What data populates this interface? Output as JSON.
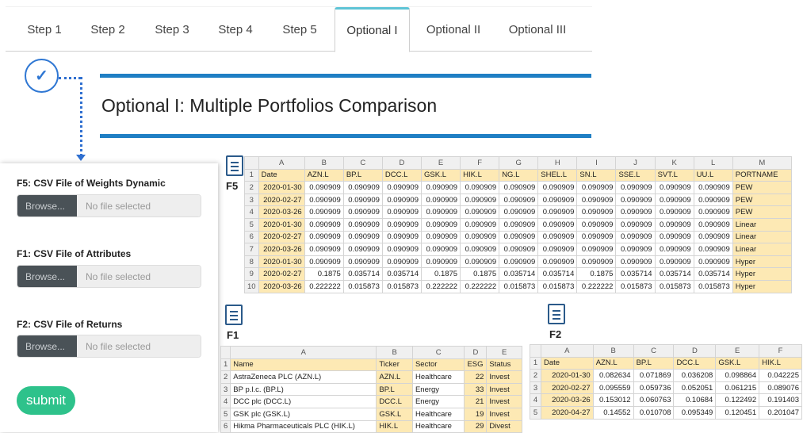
{
  "tabs": [
    "Step 1",
    "Step 2",
    "Step 3",
    "Step 4",
    "Step 5",
    "Optional I",
    "Optional II",
    "Optional III"
  ],
  "active_tab": "Optional I",
  "page_title": "Optional I: Multiple Portfolios Comparison",
  "check_glyph": "✓",
  "files": [
    {
      "label": "F5: CSV File of Weights Dynamic",
      "browse": "Browse...",
      "placeholder": "No file selected"
    },
    {
      "label": "F1: CSV File of Attributes",
      "browse": "Browse...",
      "placeholder": "No file selected"
    },
    {
      "label": "F2: CSV File of Returns",
      "browse": "Browse...",
      "placeholder": "No file selected"
    }
  ],
  "submit_label": "submit",
  "doc_labels": {
    "f5": "F5",
    "f1": "F1",
    "f2": "F2"
  },
  "f5": {
    "cols": [
      "A",
      "B",
      "C",
      "D",
      "E",
      "F",
      "G",
      "H",
      "I",
      "J",
      "K",
      "L",
      "M"
    ],
    "rows": [
      [
        "1",
        "Date",
        "AZN.L",
        "BP.L",
        "DCC.L",
        "GSK.L",
        "HIK.L",
        "NG.L",
        "SHEL.L",
        "SN.L",
        "SSE.L",
        "SVT.L",
        "UU.L",
        "PORTNAME"
      ],
      [
        "2",
        "2020-01-30",
        "0.090909",
        "0.090909",
        "0.090909",
        "0.090909",
        "0.090909",
        "0.090909",
        "0.090909",
        "0.090909",
        "0.090909",
        "0.090909",
        "0.090909",
        "PEW"
      ],
      [
        "3",
        "2020-02-27",
        "0.090909",
        "0.090909",
        "0.090909",
        "0.090909",
        "0.090909",
        "0.090909",
        "0.090909",
        "0.090909",
        "0.090909",
        "0.090909",
        "0.090909",
        "PEW"
      ],
      [
        "4",
        "2020-03-26",
        "0.090909",
        "0.090909",
        "0.090909",
        "0.090909",
        "0.090909",
        "0.090909",
        "0.090909",
        "0.090909",
        "0.090909",
        "0.090909",
        "0.090909",
        "PEW"
      ],
      [
        "5",
        "2020-01-30",
        "0.090909",
        "0.090909",
        "0.090909",
        "0.090909",
        "0.090909",
        "0.090909",
        "0.090909",
        "0.090909",
        "0.090909",
        "0.090909",
        "0.090909",
        "Linear"
      ],
      [
        "6",
        "2020-02-27",
        "0.090909",
        "0.090909",
        "0.090909",
        "0.090909",
        "0.090909",
        "0.090909",
        "0.090909",
        "0.090909",
        "0.090909",
        "0.090909",
        "0.090909",
        "Linear"
      ],
      [
        "7",
        "2020-03-26",
        "0.090909",
        "0.090909",
        "0.090909",
        "0.090909",
        "0.090909",
        "0.090909",
        "0.090909",
        "0.090909",
        "0.090909",
        "0.090909",
        "0.090909",
        "Linear"
      ],
      [
        "8",
        "2020-01-30",
        "0.090909",
        "0.090909",
        "0.090909",
        "0.090909",
        "0.090909",
        "0.090909",
        "0.090909",
        "0.090909",
        "0.090909",
        "0.090909",
        "0.090909",
        "Hyper"
      ],
      [
        "9",
        "2020-02-27",
        "0.1875",
        "0.035714",
        "0.035714",
        "0.1875",
        "0.1875",
        "0.035714",
        "0.035714",
        "0.1875",
        "0.035714",
        "0.035714",
        "0.035714",
        "Hyper"
      ],
      [
        "10",
        "2020-03-26",
        "0.222222",
        "0.015873",
        "0.015873",
        "0.222222",
        "0.222222",
        "0.015873",
        "0.015873",
        "0.222222",
        "0.015873",
        "0.015873",
        "0.015873",
        "Hyper"
      ]
    ]
  },
  "f1": {
    "cols": [
      "A",
      "B",
      "C",
      "D",
      "E"
    ],
    "rows": [
      [
        "1",
        "Name",
        "Ticker",
        "Sector",
        "ESG",
        "Status"
      ],
      [
        "2",
        "AstraZeneca PLC (AZN.L)",
        "AZN.L",
        "Healthcare",
        "22",
        "Invest"
      ],
      [
        "3",
        "BP p.l.c. (BP.L)",
        "BP.L",
        "Energy",
        "33",
        "Invest"
      ],
      [
        "4",
        "DCC plc (DCC.L)",
        "DCC.L",
        "Energy",
        "21",
        "Invest"
      ],
      [
        "5",
        "GSK plc (GSK.L)",
        "GSK.L",
        "Healthcare",
        "19",
        "Invest"
      ],
      [
        "6",
        "Hikma Pharmaceuticals PLC (HIK.L)",
        "HIK.L",
        "Healthcare",
        "29",
        "Divest"
      ]
    ]
  },
  "f2": {
    "cols": [
      "A",
      "B",
      "C",
      "D",
      "E",
      "F"
    ],
    "rows": [
      [
        "1",
        "Date",
        "AZN.L",
        "BP.L",
        "DCC.L",
        "GSK.L",
        "HIK.L"
      ],
      [
        "2",
        "2020-01-30",
        "0.082634",
        "0.071869",
        "0.036208",
        "0.098864",
        "0.042225"
      ],
      [
        "3",
        "2020-02-27",
        "0.095559",
        "0.059736",
        "0.052051",
        "0.061215",
        "0.089076"
      ],
      [
        "4",
        "2020-03-26",
        "0.153012",
        "0.060763",
        "0.10684",
        "0.122492",
        "0.191403"
      ],
      [
        "5",
        "2020-04-27",
        "0.14552",
        "0.010708",
        "0.095349",
        "0.120451",
        "0.201047"
      ]
    ]
  }
}
